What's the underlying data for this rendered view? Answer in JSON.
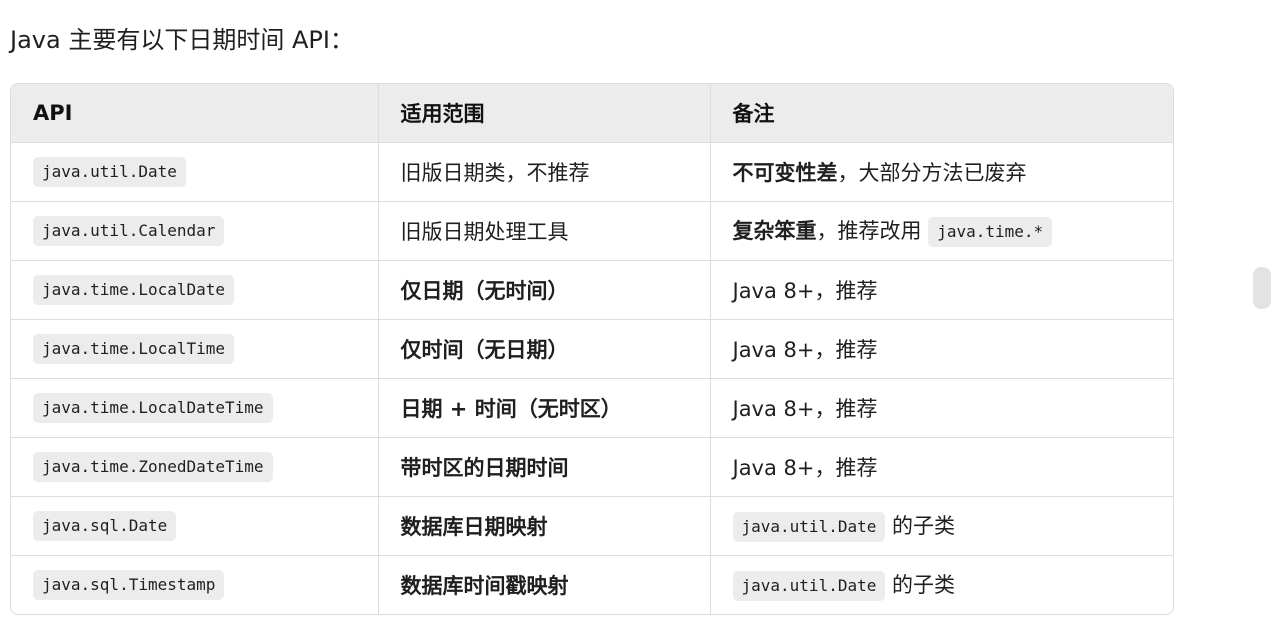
{
  "intro_text": "Java 主要有以下日期时间 API：",
  "table": {
    "headers": [
      "API",
      "适用范围",
      "备注"
    ],
    "rows": [
      {
        "api": "java.util.Date",
        "scope": "旧版日期类，不推荐",
        "scope_bold": false,
        "note_bold": "不可变性差",
        "note_text": "，大部分方法已废弃",
        "note_code": ""
      },
      {
        "api": "java.util.Calendar",
        "scope": "旧版日期处理工具",
        "scope_bold": false,
        "note_bold": "复杂笨重",
        "note_text": "，推荐改用",
        "note_code": "java.time.*"
      },
      {
        "api": "java.time.LocalDate",
        "scope": "仅日期（无时间）",
        "scope_bold": true,
        "note_bold": "",
        "note_text": "Java 8+，推荐",
        "note_code": ""
      },
      {
        "api": "java.time.LocalTime",
        "scope": "仅时间（无日期）",
        "scope_bold": true,
        "note_bold": "",
        "note_text": "Java 8+，推荐",
        "note_code": ""
      },
      {
        "api": "java.time.LocalDateTime",
        "scope": "日期 + 时间（无时区）",
        "scope_bold": true,
        "note_bold": "",
        "note_text": "Java 8+，推荐",
        "note_code": ""
      },
      {
        "api": "java.time.ZonedDateTime",
        "scope": "带时区的日期时间",
        "scope_bold": true,
        "note_bold": "",
        "note_text": "Java 8+，推荐",
        "note_code": ""
      },
      {
        "api": "java.sql.Date",
        "scope": "数据库日期映射",
        "scope_bold": true,
        "note_bold": "",
        "note_code_prefix": "java.util.Date",
        "note_text": " 的子类",
        "note_code": ""
      },
      {
        "api": "java.sql.Timestamp",
        "scope": "数据库时间戳映射",
        "scope_bold": true,
        "note_bold": "",
        "note_code_prefix": "java.util.Date",
        "note_text": " 的子类",
        "note_code": ""
      }
    ]
  },
  "colors": {
    "header_bg": "#ececec",
    "code_bg": "#ececec",
    "border": "#dcdcdc",
    "scroll_handle": "#e3e3e3"
  }
}
